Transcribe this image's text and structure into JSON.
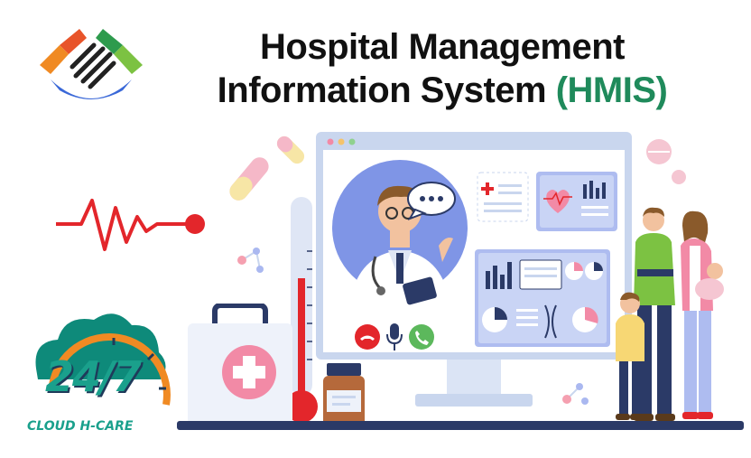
{
  "title": {
    "line1": "Hospital Management",
    "line2": "Information System ",
    "acronym": "(HMIS)"
  },
  "badge": {
    "number": "24/7",
    "brand": "CLOUD H-CARE"
  },
  "colors": {
    "accent_green": "#1f8a5b",
    "heartbeat_red": "#e3262b",
    "screen_border": "#c9d6ee",
    "doctor_circle": "#7f95e6",
    "badge_teal": "#0e8a7a",
    "badge_orange": "#f08a23"
  },
  "icons": [
    "logo-icon",
    "heartbeat-icon",
    "end-call-icon",
    "microphone-icon",
    "accept-call-icon",
    "chat-bubble-icon"
  ]
}
